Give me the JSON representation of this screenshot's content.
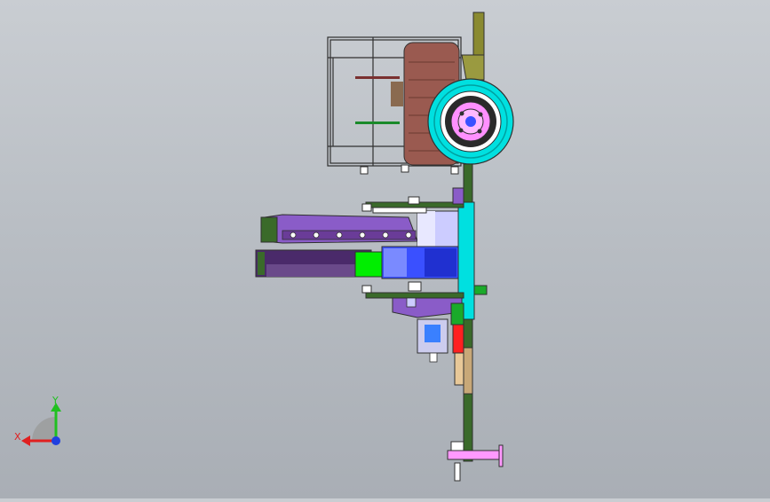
{
  "triad": {
    "x_label": "X",
    "y_label": "Y",
    "x_color": "#e02020",
    "y_color": "#20c020",
    "z_color": "#2040e0"
  },
  "colors": {
    "background_top": "#c9cdd2",
    "background_bottom": "#a9aeb5",
    "frame_outline": "#303030",
    "wheel_tire": "#00e0e0",
    "wheel_hub": "#ff90ff",
    "tank": "#9a5a50",
    "chassis_green": "#3a6a2a",
    "mower_purple": "#8a5cc8",
    "drum_blue": "#3a50ff",
    "accent_green": "#00ee00",
    "red_part": "#ff2020",
    "pink_part": "#ff99ff",
    "mast_olive": "#8a8a30"
  }
}
